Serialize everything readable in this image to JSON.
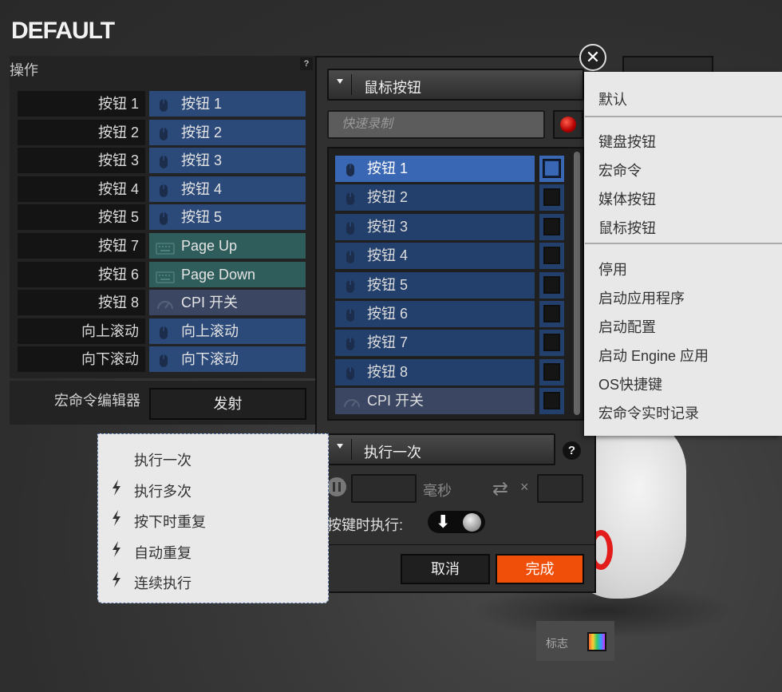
{
  "profile": {
    "title": "DEFAULT"
  },
  "actions_panel": {
    "header": "操作",
    "help": "?",
    "rows": [
      {
        "label": "按钮 1",
        "assign": "按钮 1",
        "kind": "mouse"
      },
      {
        "label": "按钮 2",
        "assign": "按钮 2",
        "kind": "mouse"
      },
      {
        "label": "按钮 3",
        "assign": "按钮 3",
        "kind": "mouse"
      },
      {
        "label": "按钮 4",
        "assign": "按钮 4",
        "kind": "mouse"
      },
      {
        "label": "按钮 5",
        "assign": "按钮 5",
        "kind": "mouse"
      },
      {
        "label": "按钮 7",
        "assign": "Page Up",
        "kind": "keyboard"
      },
      {
        "label": "按钮 6",
        "assign": "Page Down",
        "kind": "keyboard"
      },
      {
        "label": "按钮 8",
        "assign": "CPI 开关",
        "kind": "cpi"
      },
      {
        "label": "向上滚动",
        "assign": "向上滚动",
        "kind": "mouse"
      },
      {
        "label": "向下滚动",
        "assign": "向下滚动",
        "kind": "mouse"
      }
    ],
    "macro_editor_label": "宏命令编辑器",
    "fire_label": "发射"
  },
  "dialog": {
    "type_dropdown": "鼠标按钮",
    "quick_record_placeholder": "快速录制",
    "list": [
      {
        "label": "按钮 1",
        "selected": true,
        "kind": "mouse"
      },
      {
        "label": "按钮 2",
        "selected": false,
        "kind": "mouse"
      },
      {
        "label": "按钮 3",
        "selected": false,
        "kind": "mouse"
      },
      {
        "label": "按钮 4",
        "selected": false,
        "kind": "mouse"
      },
      {
        "label": "按钮 5",
        "selected": false,
        "kind": "mouse"
      },
      {
        "label": "按钮 6",
        "selected": false,
        "kind": "mouse"
      },
      {
        "label": "按钮 7",
        "selected": false,
        "kind": "mouse"
      },
      {
        "label": "按钮 8",
        "selected": false,
        "kind": "mouse"
      },
      {
        "label": "CPI 开关",
        "selected": false,
        "kind": "cpi"
      }
    ],
    "exec_dropdown": "执行一次",
    "help": "?",
    "ms_label": "毫秒",
    "times_symbol": "×",
    "on_press_label": "按键时执行:",
    "cancel_label": "取消",
    "done_label": "完成"
  },
  "close_symbol": "✕",
  "type_menu": {
    "items": [
      {
        "label": "默认",
        "group": 0
      },
      {
        "label": "键盘按钮",
        "group": 1
      },
      {
        "label": "宏命令",
        "group": 1
      },
      {
        "label": "媒体按钮",
        "group": 1
      },
      {
        "label": "鼠标按钮",
        "group": 1
      },
      {
        "label": "停用",
        "group": 2
      },
      {
        "label": "启动应用程序",
        "group": 2
      },
      {
        "label": "启动配置",
        "group": 2
      },
      {
        "label": "启动 Engine 应用",
        "group": 2
      },
      {
        "label": "OS快捷键",
        "group": 2
      },
      {
        "label": "宏命令实时记录",
        "group": 2
      }
    ]
  },
  "exec_menu": {
    "items": [
      {
        "label": "执行一次",
        "bolt": false
      },
      {
        "label": "执行多次",
        "bolt": true
      },
      {
        "label": "按下时重复",
        "bolt": true
      },
      {
        "label": "自动重复",
        "bolt": true
      },
      {
        "label": "连续执行",
        "bolt": true
      }
    ]
  },
  "logo": {
    "label": "标志"
  },
  "colors": {
    "accent_orange": "#ef4f08",
    "mouse_assign": "#2b4a7a",
    "keyboard_assign": "#2f5d5b",
    "selected_blue": "#3a67b4",
    "record_red": "#cc0000"
  }
}
